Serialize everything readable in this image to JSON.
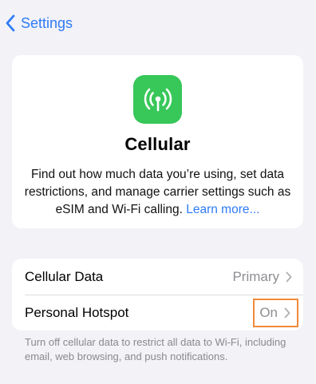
{
  "nav": {
    "back_label": "Settings"
  },
  "header": {
    "icon": "cellular-antenna-icon",
    "title": "Cellular",
    "description": "Find out how much data you’re using, set data restrictions, and manage carrier settings such as eSIM and Wi-Fi calling.",
    "learn_more": "Learn more..."
  },
  "settings": {
    "rows": [
      {
        "label": "Cellular Data",
        "value": "Primary"
      },
      {
        "label": "Personal Hotspot",
        "value": "On"
      }
    ]
  },
  "footer": {
    "note": "Turn off cellular data to restrict all data to Wi-Fi, including email, web browsing, and push notifications."
  },
  "colors": {
    "accent": "#2f7bf6",
    "icon_background": "#38c759",
    "highlight": "#f08a3a",
    "background": "#f2f2f7"
  }
}
